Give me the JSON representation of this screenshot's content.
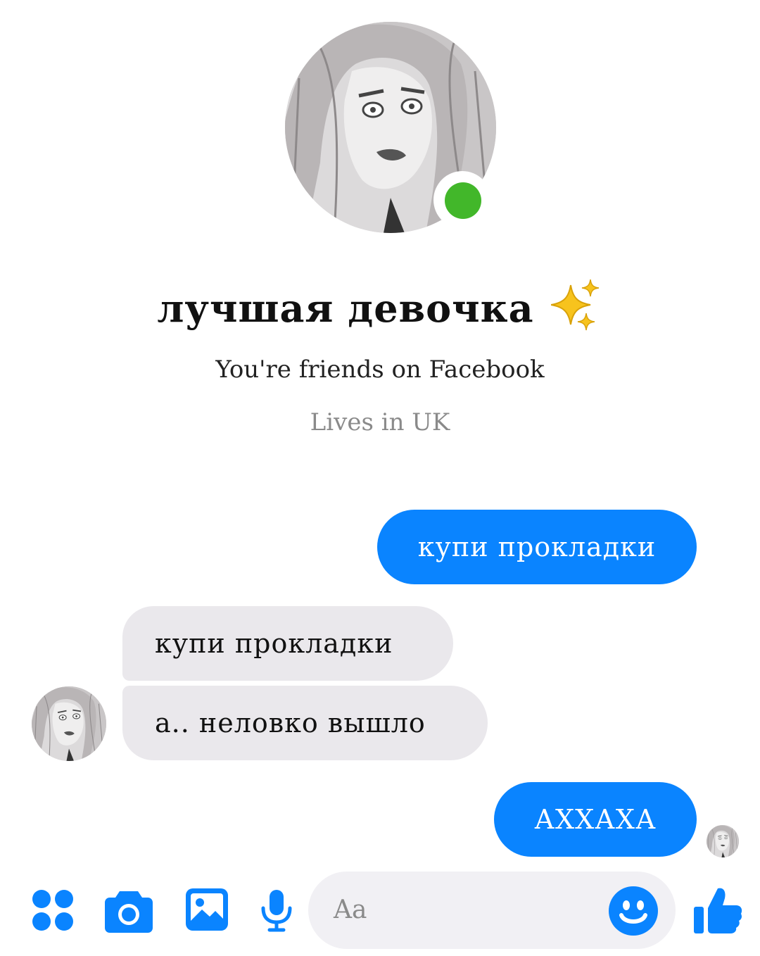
{
  "profile": {
    "name": "лучшая девочка",
    "name_emoji_icon": "sparkles-icon",
    "friends_text": "You're friends on Facebook",
    "location_text": "Lives in UK",
    "online": true,
    "online_color": "#42b72a"
  },
  "messages": [
    {
      "direction": "outgoing",
      "text": "купи прокладки"
    },
    {
      "direction": "incoming",
      "text": "купи прокладки"
    },
    {
      "direction": "incoming",
      "text": "а.. неловко вышло"
    },
    {
      "direction": "outgoing",
      "text": "АХХАХА"
    }
  ],
  "composer": {
    "placeholder": "Aa",
    "icons": [
      "apps-icon",
      "camera-icon",
      "gallery-icon",
      "microphone-icon",
      "emoji-icon",
      "thumbs-up-icon"
    ]
  },
  "colors": {
    "accent": "#0a84ff",
    "incoming_bubble": "#eae8ec",
    "input_background": "#f1f0f4",
    "background": "#ffffff"
  }
}
